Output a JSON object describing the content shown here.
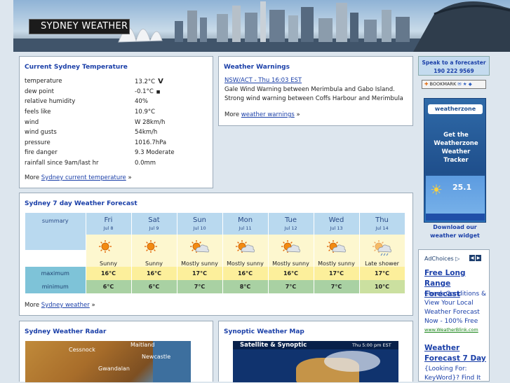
{
  "header": {
    "title": "SYDNEY WEATHER"
  },
  "current": {
    "heading": "Current Sydney Temperature",
    "rows": [
      {
        "label": "temperature",
        "value": "13.2°C",
        "mark": "V"
      },
      {
        "label": "dew point",
        "value": "-0.1°C",
        "mark": "■"
      },
      {
        "label": "relative humidity",
        "value": "40%"
      },
      {
        "label": "feels like",
        "value": "10.9°C"
      },
      {
        "label": "wind",
        "value": "W 28km/h"
      },
      {
        "label": "wind gusts",
        "value": "54km/h"
      },
      {
        "label": "pressure",
        "value": "1016.7hPa"
      },
      {
        "label": "fire danger",
        "value": "9.3 Moderate"
      },
      {
        "label": "rainfall since 9am/last hr",
        "value": "0.0mm"
      }
    ],
    "more_prefix": "More",
    "more_link": "Sydney current temperature",
    "more_suffix": "»"
  },
  "warnings": {
    "heading": "Weather Warnings",
    "item_link": "NSW/ACT - Thu 16:03 EST",
    "item_text": "Gale Wind Warning between Merimbula and Gabo Island. Strong wind warning between Coffs Harbour and Merimbula",
    "more_prefix": "More",
    "more_link": "weather warnings",
    "more_suffix": "»"
  },
  "forecast": {
    "heading": "Sydney 7 day Weather Forecast",
    "labels": {
      "summary": "summary",
      "maximum": "maximum",
      "minimum": "minimum"
    },
    "days": [
      {
        "day": "Fri",
        "date": "Jul 8",
        "summary": "Sunny",
        "icon": "sunny-icon",
        "max": "16°C",
        "min": "6°C"
      },
      {
        "day": "Sat",
        "date": "Jul 9",
        "summary": "Sunny",
        "icon": "sunny-icon",
        "max": "16°C",
        "min": "6°C"
      },
      {
        "day": "Sun",
        "date": "Jul 10",
        "summary": "Mostly sunny",
        "icon": "mostly-sunny-icon",
        "max": "17°C",
        "min": "7°C"
      },
      {
        "day": "Mon",
        "date": "Jul 11",
        "summary": "Mostly sunny",
        "icon": "mostly-sunny-icon",
        "max": "16°C",
        "min": "8°C"
      },
      {
        "day": "Tue",
        "date": "Jul 12",
        "summary": "Mostly sunny",
        "icon": "mostly-sunny-icon",
        "max": "16°C",
        "min": "7°C"
      },
      {
        "day": "Wed",
        "date": "Jul 13",
        "summary": "Mostly sunny",
        "icon": "mostly-sunny-icon",
        "max": "17°C",
        "min": "7°C"
      },
      {
        "day": "Thu",
        "date": "Jul 14",
        "summary": "Late shower",
        "icon": "late-shower-icon",
        "max": "17°C",
        "min": "10°C"
      }
    ],
    "more_prefix": "More",
    "more_link": "Sydney weather",
    "more_suffix": "»"
  },
  "radar": {
    "heading": "Sydney Weather Radar",
    "places": [
      "Cessnock",
      "Maitland",
      "Newcastle",
      "Gwandalan"
    ]
  },
  "synoptic": {
    "heading": "Synoptic Weather Map",
    "map_title": "Satellite & Synoptic",
    "map_time": "Thu 5:00 pm EST"
  },
  "sidebar": {
    "speak_line1": "Speak to a forecaster",
    "speak_line2": "190 222 9569",
    "bookmark": "BOOKMARK",
    "widget_brand": "weatherzone",
    "widget_text": "Get the Weatherzone Weather Tracker",
    "widget_temp": "25.1",
    "widget_link": "Download our weather widget",
    "ad": {
      "choices": "AdChoices",
      "link1": "Free Long Range Forecast",
      "body1": "Check Conditions & View Your Local Weather Forecast Now - 100% Free",
      "url1": "www.WeatherBlink.com",
      "link2": "Weather Forecast 7 Day",
      "body2": "{Looking For: KeyWord}? Find It"
    }
  },
  "colors": {
    "accent": "#1a3fa8",
    "header_cell": "#b9d9ef",
    "max_cell": "#fcef9b",
    "min_cell": "#a9d1a3"
  }
}
